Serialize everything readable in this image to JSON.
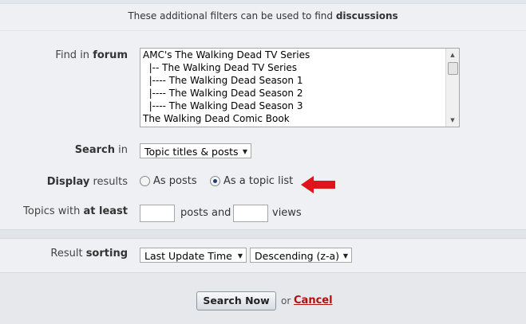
{
  "intro": {
    "prefix": "These additional filters can be used to find ",
    "bold": "discussions"
  },
  "find_in_forum": {
    "label_prefix": "Find in ",
    "label_bold": "forum",
    "options": [
      "AMC's The Walking Dead TV Series",
      "  |-- The Walking Dead TV Series",
      "  |---- The Walking Dead Season 1",
      "  |---- The Walking Dead Season 2",
      "  |---- The Walking Dead Season 3",
      "The Walking Dead Comic Book"
    ]
  },
  "search_in": {
    "label_bold": "Search",
    "label_suffix": " in",
    "selected": "Topic titles & posts"
  },
  "display_results": {
    "label_bold": "Display",
    "label_suffix": " results",
    "options": [
      {
        "label": "As posts",
        "checked": false
      },
      {
        "label": "As a topic list",
        "checked": true
      }
    ]
  },
  "topics_with": {
    "label_prefix": "Topics with ",
    "label_bold": "at least",
    "posts_value": "",
    "posts_label": "posts and",
    "views_value": "",
    "views_label": "views"
  },
  "result_sorting": {
    "label_prefix": "Result ",
    "label_bold": "sorting",
    "sort_by": "Last Update Time",
    "order": "Descending (z-a)"
  },
  "actions": {
    "submit": "Search Now",
    "or": "or",
    "cancel": "Cancel"
  },
  "colors": {
    "cancel": "#b01010",
    "annotation_arrow": "#e0141b",
    "radio_dot": "#1a3f73"
  }
}
